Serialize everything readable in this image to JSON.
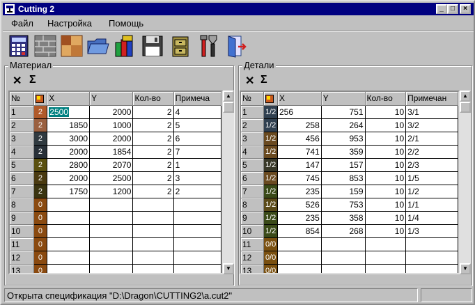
{
  "window": {
    "title": "Cutting 2"
  },
  "menu": [
    "Файл",
    "Настройка",
    "Помощь"
  ],
  "toolbar": [
    {
      "icon": "calculator-icon"
    },
    {
      "icon": "brick-wall-icon"
    },
    {
      "icon": "wood-panel-icon"
    },
    {
      "icon": "open-folder-icon"
    },
    {
      "icon": "books-icon"
    },
    {
      "icon": "floppy-save-icon"
    },
    {
      "icon": "file-cabinet-icon"
    },
    {
      "icon": "tools-icon"
    },
    {
      "icon": "exit-door-icon"
    }
  ],
  "material": {
    "label": "Материал",
    "delete_glyph": "✕",
    "sum_glyph": "Σ",
    "columns": [
      "№",
      "",
      "X",
      "Y",
      "Кол-во",
      "Примеча"
    ],
    "rows": [
      {
        "n": "1",
        "sw": "2",
        "color": "#b05a2a",
        "x": "2500",
        "y": "2000",
        "q": "2",
        "note": "4",
        "selected": true
      },
      {
        "n": "2",
        "sw": "2",
        "color": "#9a6040",
        "x": "1850",
        "y": "1000",
        "q": "2",
        "note": "5"
      },
      {
        "n": "3",
        "sw": "2",
        "color": "#303a40",
        "x": "3000",
        "y": "2000",
        "q": "2",
        "note": "6"
      },
      {
        "n": "4",
        "sw": "2",
        "color": "#283038",
        "x": "2000",
        "y": "1854",
        "q": "2",
        "note": "7"
      },
      {
        "n": "5",
        "sw": "2",
        "color": "#5a5010",
        "x": "2800",
        "y": "2070",
        "q": "2",
        "note": "1"
      },
      {
        "n": "6",
        "sw": "2",
        "color": "#4a3a10",
        "x": "2000",
        "y": "2500",
        "q": "2",
        "note": "3"
      },
      {
        "n": "7",
        "sw": "2",
        "color": "#3a3410",
        "x": "1750",
        "y": "1200",
        "q": "2",
        "note": "2"
      },
      {
        "n": "8",
        "sw": "0",
        "color": "#8a4a10"
      },
      {
        "n": "9",
        "sw": "0",
        "color": "#8a4a10"
      },
      {
        "n": "10",
        "sw": "0",
        "color": "#8a4a10"
      },
      {
        "n": "11",
        "sw": "0",
        "color": "#8a4a10"
      },
      {
        "n": "12",
        "sw": "0",
        "color": "#8a4a10"
      },
      {
        "n": "13",
        "sw": "0",
        "color": "#8a4a10"
      }
    ]
  },
  "details": {
    "label": "Детали",
    "delete_glyph": "✕",
    "sum_glyph": "Σ",
    "columns": [
      "№",
      "",
      "X",
      "Y",
      "Кол-во",
      "Примечан"
    ],
    "rows": [
      {
        "n": "1",
        "sw": "1/2",
        "color": "#304050",
        "x": "256",
        "y": "751",
        "q": "10",
        "note": "3/1",
        "left": true
      },
      {
        "n": "2",
        "sw": "1/2",
        "color": "#304050",
        "x": "258",
        "y": "264",
        "q": "10",
        "note": "3/2"
      },
      {
        "n": "3",
        "sw": "1/2",
        "color": "#6a4a20",
        "x": "456",
        "y": "953",
        "q": "10",
        "note": "2/1"
      },
      {
        "n": "4",
        "sw": "1/2",
        "color": "#6a4a20",
        "x": "741",
        "y": "359",
        "q": "10",
        "note": "2/2"
      },
      {
        "n": "5",
        "sw": "1/2",
        "color": "#383828",
        "x": "147",
        "y": "157",
        "q": "10",
        "note": "2/3"
      },
      {
        "n": "6",
        "sw": "1/2",
        "color": "#6a4a20",
        "x": "745",
        "y": "853",
        "q": "10",
        "note": "1/5"
      },
      {
        "n": "7",
        "sw": "1/2",
        "color": "#3a4a18",
        "x": "235",
        "y": "159",
        "q": "10",
        "note": "1/2"
      },
      {
        "n": "8",
        "sw": "1/2",
        "color": "#5a4a18",
        "x": "526",
        "y": "753",
        "q": "10",
        "note": "1/1"
      },
      {
        "n": "9",
        "sw": "1/2",
        "color": "#3a4a18",
        "x": "235",
        "y": "358",
        "q": "10",
        "note": "1/4"
      },
      {
        "n": "10",
        "sw": "1/2",
        "color": "#3a4a18",
        "x": "854",
        "y": "268",
        "q": "10",
        "note": "1/3"
      },
      {
        "n": "11",
        "sw": "0/0",
        "color": "#7a5010"
      },
      {
        "n": "12",
        "sw": "0/0",
        "color": "#7a5010"
      },
      {
        "n": "13",
        "sw": "0/0",
        "color": "#7a5010"
      }
    ]
  },
  "status": {
    "text": "Открыта спецификация \"D:\\Dragon\\CUTTING2\\a.cut2\""
  }
}
